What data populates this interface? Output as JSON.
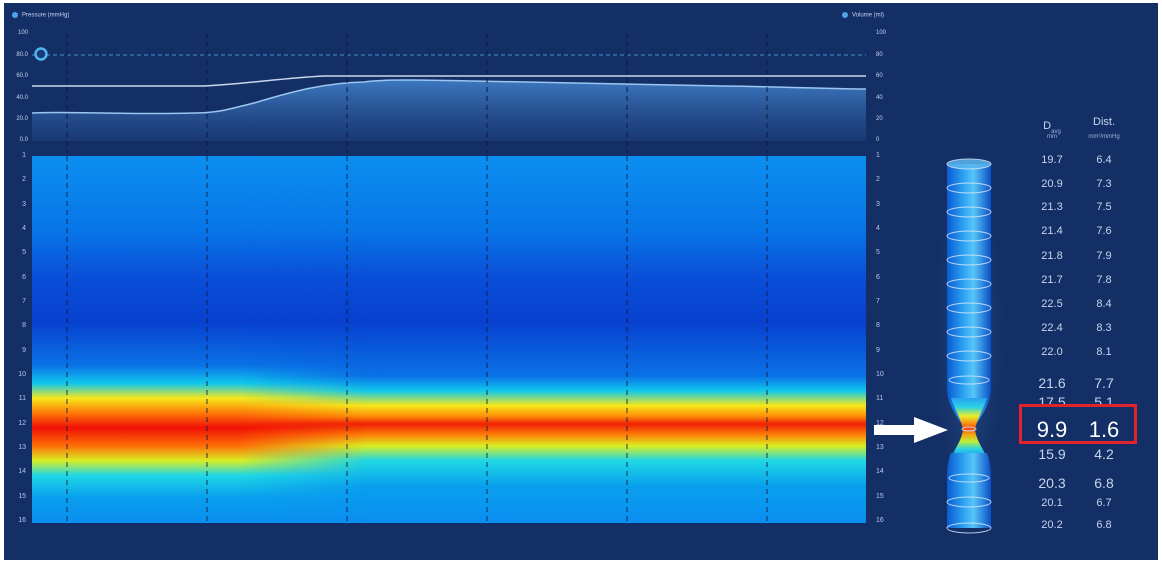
{
  "legend": {
    "pressure": "Pressure (mmHg)",
    "volume": "Volume (ml)"
  },
  "pressure_axis_labels": [
    "100",
    "80.0",
    "60.0",
    "40.0",
    "20.0",
    "0.0"
  ],
  "volume_axis_labels": [
    "100",
    "80",
    "60",
    "40",
    "20",
    "0"
  ],
  "sensor_row_labels": [
    "1",
    "2",
    "3",
    "4",
    "5",
    "6",
    "7",
    "8",
    "9",
    "10",
    "11",
    "12",
    "13",
    "14",
    "15",
    "16"
  ],
  "table": {
    "col1_header": "D",
    "col1_header_sub": "avg",
    "col1_unit": "mm",
    "col2_header": "Dist.",
    "col2_unit": "mm²/mmHg",
    "rows": [
      {
        "d": "19.7",
        "dist": "6.4"
      },
      {
        "d": "20.9",
        "dist": "7.3"
      },
      {
        "d": "21.3",
        "dist": "7.5"
      },
      {
        "d": "21.4",
        "dist": "7.6"
      },
      {
        "d": "21.8",
        "dist": "7.9"
      },
      {
        "d": "21.7",
        "dist": "7.8"
      },
      {
        "d": "22.5",
        "dist": "8.4"
      },
      {
        "d": "22.4",
        "dist": "8.3"
      },
      {
        "d": "22.0",
        "dist": "8.1"
      },
      {
        "d": "21.6",
        "dist": "7.7"
      },
      {
        "d": "17.5",
        "dist": "5.1"
      },
      {
        "d": "9.9",
        "dist": "1.6"
      },
      {
        "d": "15.9",
        "dist": "4.2"
      },
      {
        "d": "20.3",
        "dist": "6.8"
      },
      {
        "d": "20.1",
        "dist": "6.7"
      },
      {
        "d": "20.2",
        "dist": "6.8"
      }
    ],
    "highlighted_row": 12
  },
  "colors": {
    "background": "#142f66",
    "plot_background": "#1d3f7e",
    "highlight": "#e3232b",
    "pressure_line": "#c9d7ee",
    "volume_fill": "#3d77bd"
  },
  "icons": {
    "pressure_marker": "circle-marker-icon",
    "arrow": "right-arrow-icon"
  }
}
